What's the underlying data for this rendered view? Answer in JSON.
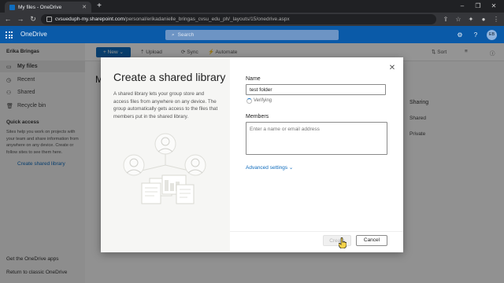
{
  "browser": {
    "tab_title": "My files - OneDrive",
    "url_domain": "cvsueduph-my.sharepoint.com",
    "url_path": "/personal/erikadanielle_bringas_cvsu_edu_ph/_layouts/15/onedrive.aspx"
  },
  "app": {
    "brand": "OneDrive",
    "search_placeholder": "Search",
    "avatar_initials": "EB"
  },
  "sidebar": {
    "user": "Erika Bringas",
    "items": [
      {
        "label": "My files"
      },
      {
        "label": "Recent"
      },
      {
        "label": "Shared"
      },
      {
        "label": "Recycle bin"
      }
    ],
    "quick_access_title": "Quick access",
    "quick_access_text": "Sites help you work on projects with your team and share information from anywhere on any device. Create or follow sites to see them here.",
    "create_link": "Create shared library",
    "get_apps": "Get the OneDrive apps",
    "return_classic": "Return to classic OneDrive"
  },
  "commandbar": {
    "new": "New",
    "upload": "Upload",
    "sync": "Sync",
    "automate": "Automate",
    "sort": "Sort"
  },
  "content": {
    "heading_letter": "M",
    "sharing_header": "Sharing",
    "rows": [
      "Shared",
      "Private"
    ]
  },
  "dialog": {
    "title": "Create a shared library",
    "description": "A shared library lets your group store and access files from anywhere on any device. The group automatically gets access to the files that members put in the shared library.",
    "name_label": "Name",
    "name_value": "test folder",
    "verifying": "Verifying",
    "members_label": "Members",
    "members_placeholder": "Enter a name or email address",
    "advanced": "Advanced settings",
    "create": "Create",
    "cancel": "Cancel"
  },
  "colors": {
    "accent": "#0f6cbd",
    "header": "#0a5aa8"
  }
}
